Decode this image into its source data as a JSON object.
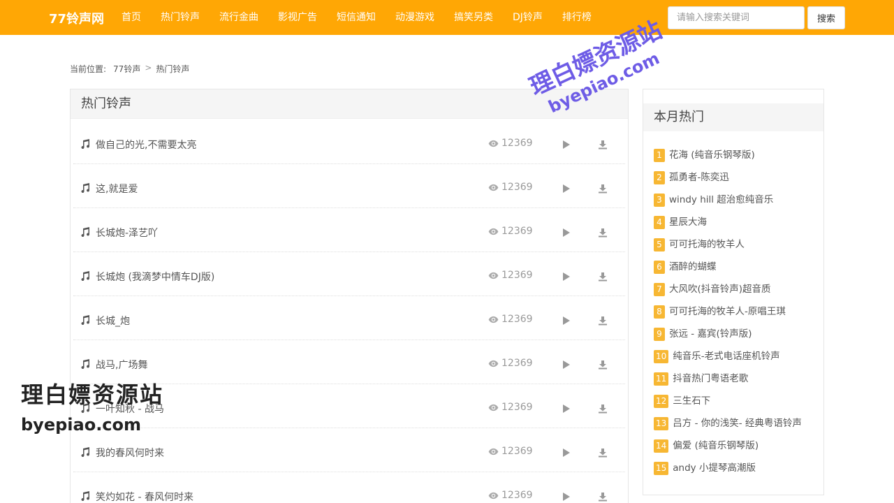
{
  "header": {
    "brand": "77铃声网",
    "nav": [
      "首页",
      "热门铃声",
      "流行金曲",
      "影视广告",
      "短信通知",
      "动漫游戏",
      "搞笑另类",
      "DJ铃声",
      "排行榜"
    ],
    "search_placeholder": "请输入搜索关键词",
    "search_button": "搜索",
    "accent_color": "#ffa705"
  },
  "breadcrumb": {
    "prefix": "当前位置:",
    "home": "77铃声",
    "separator": ">",
    "current": "热门铃声"
  },
  "main": {
    "title": "热门铃声",
    "rows": [
      {
        "title": "做自己的光,不需要太亮",
        "views": "12369"
      },
      {
        "title": "这,就是爱",
        "views": "12369"
      },
      {
        "title": "长城炮-泽艺吖",
        "views": "12369"
      },
      {
        "title": "长城炮 (我滴梦中情车DJ版)",
        "views": "12369"
      },
      {
        "title": "长城_炮",
        "views": "12369"
      },
      {
        "title": "战马,广场舞",
        "views": "12369"
      },
      {
        "title": "一叶知秋 - 战马",
        "views": "12369"
      },
      {
        "title": "我的春风何时来",
        "views": "12369"
      },
      {
        "title": "笑灼如花 - 春风何时来",
        "views": "12369"
      }
    ],
    "icons": {
      "song": "music-note-icon",
      "views": "eye-icon",
      "play": "play-icon",
      "download": "download-icon"
    }
  },
  "sidebar": {
    "title": "本月热门",
    "badge_color": "#f7b733",
    "items": [
      {
        "rank": "1",
        "name": "花海 (纯音乐钢琴版)"
      },
      {
        "rank": "2",
        "name": "孤勇者-陈奕迅"
      },
      {
        "rank": "3",
        "name": "windy hill 超治愈纯音乐"
      },
      {
        "rank": "4",
        "name": "星辰大海"
      },
      {
        "rank": "5",
        "name": "可可托海的牧羊人"
      },
      {
        "rank": "6",
        "name": "酒醉的蝴蝶"
      },
      {
        "rank": "7",
        "name": "大风吹(抖音铃声)超音质"
      },
      {
        "rank": "8",
        "name": "可可托海的牧羊人-原唱王琪"
      },
      {
        "rank": "9",
        "name": "张远 - 嘉宾(铃声版)"
      },
      {
        "rank": "10",
        "name": "纯音乐-老式电话座机铃声"
      },
      {
        "rank": "11",
        "name": "抖音热门粤语老歌"
      },
      {
        "rank": "12",
        "name": "三生石下"
      },
      {
        "rank": "13",
        "name": "吕方 - 你的浅笑-  经典粤语铃声"
      },
      {
        "rank": "14",
        "name": "偏爱 (纯音乐钢琴版)"
      },
      {
        "rank": "15",
        "name": "andy 小提琴高潮版"
      }
    ]
  },
  "watermarks": {
    "top_cn": "理白嫖资源站",
    "top_url": "byepiao.com",
    "bottom_cn": "理白嫖资源站",
    "bottom_url": "byepiao.com"
  }
}
